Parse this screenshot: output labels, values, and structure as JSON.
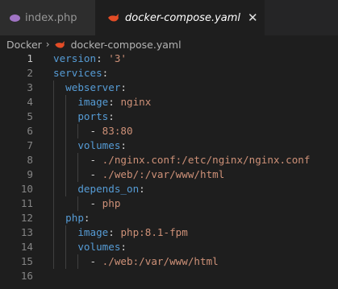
{
  "tabs": [
    {
      "label": "index.php",
      "icon": "php-icon",
      "active": false
    },
    {
      "label": "docker-compose.yaml",
      "icon": "docker-whale-icon",
      "active": true,
      "close": "✕"
    }
  ],
  "breadcrumb": {
    "folder": "Docker",
    "separator": "›",
    "file": "docker-compose.yaml"
  },
  "editor": {
    "line_numbers": [
      "1",
      "2",
      "3",
      "4",
      "5",
      "6",
      "7",
      "8",
      "9",
      "10",
      "11",
      "12",
      "13",
      "14",
      "15",
      "16"
    ],
    "lines": [
      {
        "indent": "",
        "key": "version",
        "colon": ": ",
        "value": "'3'"
      },
      {
        "indent": "",
        "key": "services",
        "colon": ":",
        "value": ""
      },
      {
        "indent": "  ",
        "key": "webserver",
        "colon": ":",
        "value": ""
      },
      {
        "indent": "    ",
        "key": "image",
        "colon": ": ",
        "value": "nginx"
      },
      {
        "indent": "    ",
        "key": "ports",
        "colon": ":",
        "value": ""
      },
      {
        "indent": "      ",
        "dash": "- ",
        "value": "83:80"
      },
      {
        "indent": "    ",
        "key": "volumes",
        "colon": ":",
        "value": ""
      },
      {
        "indent": "      ",
        "dash": "- ",
        "value": "./nginx.conf:/etc/nginx/nginx.conf"
      },
      {
        "indent": "      ",
        "dash": "- ",
        "value": "./web/:/var/www/html"
      },
      {
        "indent": "    ",
        "key": "depends_on",
        "colon": ":",
        "value": ""
      },
      {
        "indent": "      ",
        "dash": "- ",
        "value": "php"
      },
      {
        "indent": "  ",
        "key": "php",
        "colon": ":",
        "value": ""
      },
      {
        "indent": "    ",
        "key": "image",
        "colon": ": ",
        "value": "php:8.1-fpm"
      },
      {
        "indent": "    ",
        "key": "volumes",
        "colon": ":",
        "value": ""
      },
      {
        "indent": "      ",
        "dash": "- ",
        "value": "./web:/var/www/html"
      },
      {
        "indent": "",
        "value": ""
      }
    ]
  },
  "colors": {
    "key": "#569cd6",
    "string": "#ce9178",
    "line_number": "#858585",
    "background": "#1e1e1e",
    "docker_icon": "#e34c26"
  }
}
